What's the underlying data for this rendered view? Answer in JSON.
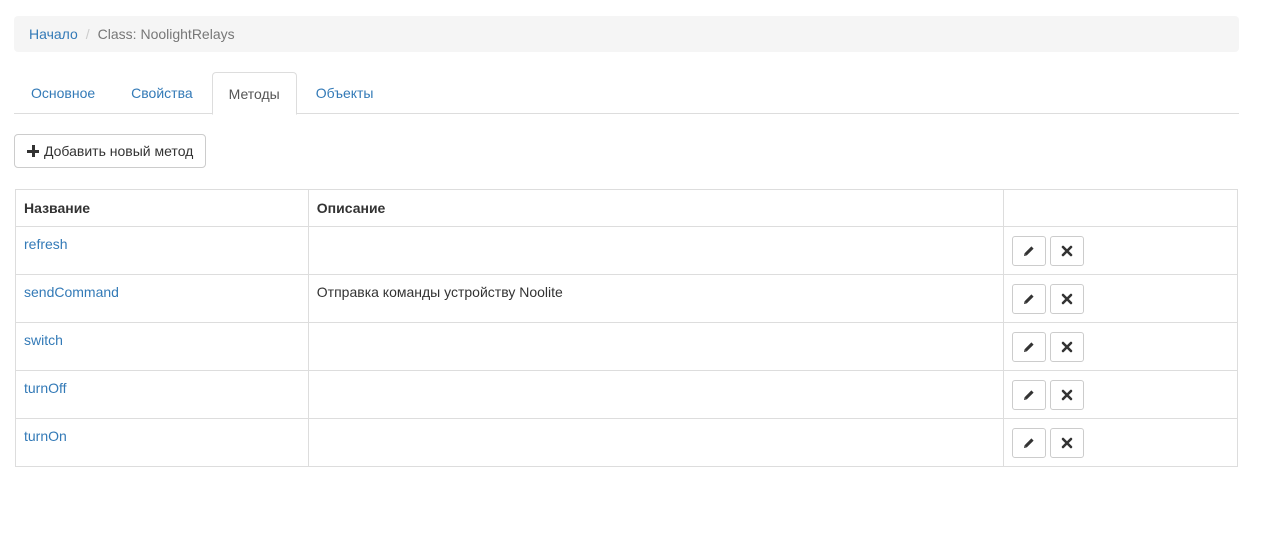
{
  "breadcrumb": {
    "home": "Начало",
    "separator": "/",
    "current": "Class: NoolightRelays"
  },
  "tabs": [
    {
      "label": "Основное",
      "active": false
    },
    {
      "label": "Свойства",
      "active": false
    },
    {
      "label": "Методы",
      "active": true
    },
    {
      "label": "Объекты",
      "active": false
    }
  ],
  "add_button": {
    "label": "Добавить новый метод",
    "icon": "plus-icon"
  },
  "table": {
    "headers": [
      "Название",
      "Описание",
      ""
    ],
    "rows": [
      {
        "name": "refresh",
        "description": ""
      },
      {
        "name": "sendCommand",
        "description": "Отправка команды устройству Noolite"
      },
      {
        "name": "switch",
        "description": ""
      },
      {
        "name": "turnOff",
        "description": ""
      },
      {
        "name": "turnOn",
        "description": ""
      }
    ],
    "row_actions": [
      "pencil-icon",
      "close-icon"
    ]
  },
  "colors": {
    "link": "#337ab7",
    "breadcrumb_bg": "#f5f5f5",
    "border": "#dddddd",
    "text": "#333333"
  }
}
